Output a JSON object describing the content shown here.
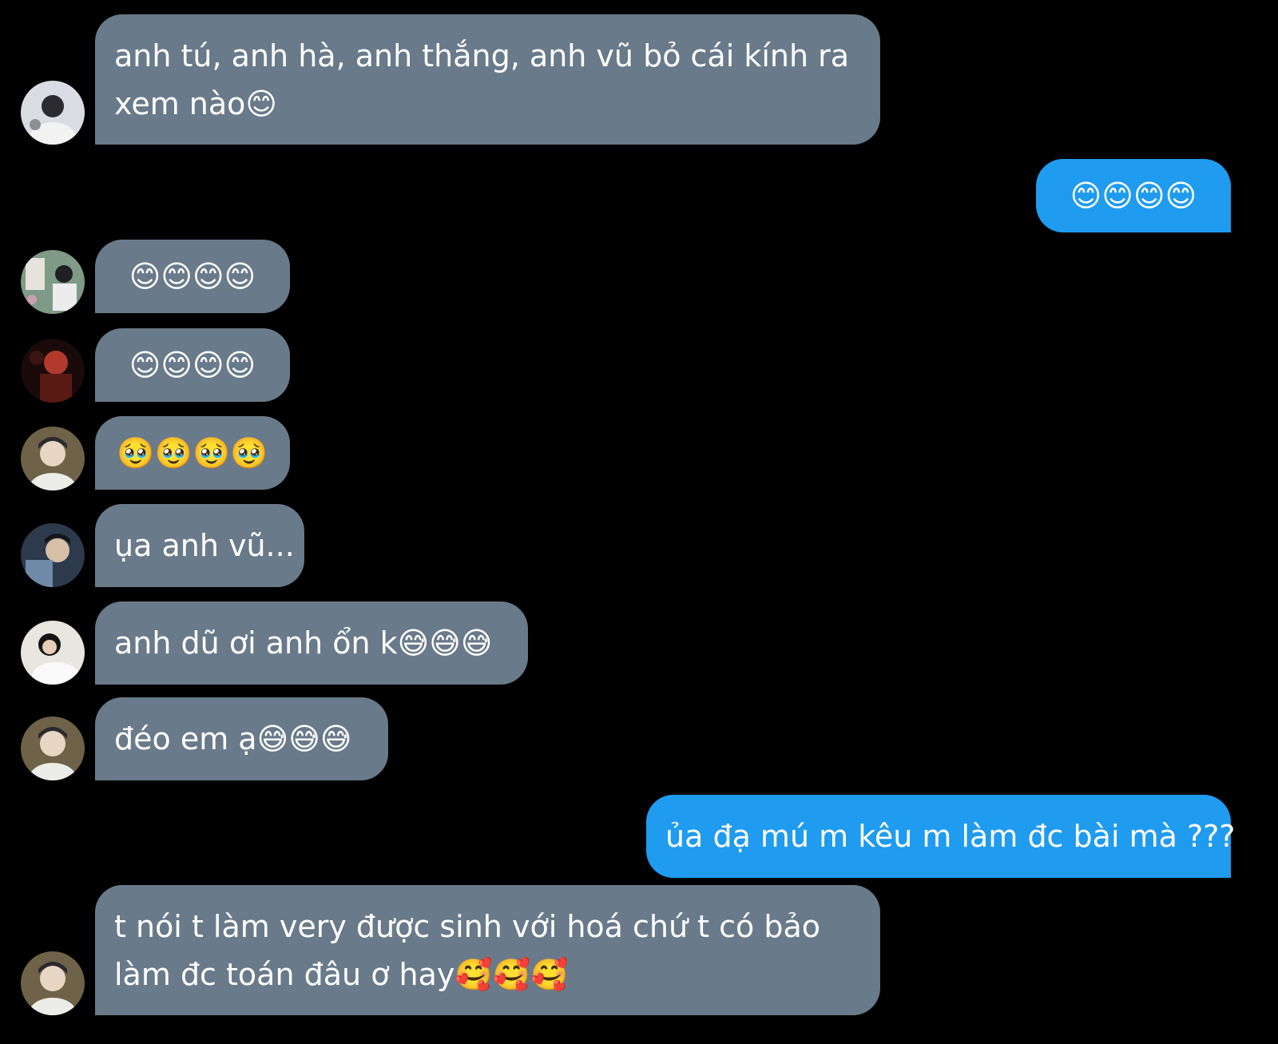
{
  "messages": [
    {
      "direction": "incoming",
      "avatar": "avatar-1",
      "text": "anh tú, anh hà, anh thắng, anh vũ bỏ cái kính ra xem nào😊"
    },
    {
      "direction": "outgoing",
      "text": "😊😊😊😊"
    },
    {
      "direction": "incoming",
      "avatar": "avatar-2",
      "text": "😊😊😊😊"
    },
    {
      "direction": "incoming",
      "avatar": "avatar-3",
      "text": "😊😊😊😊"
    },
    {
      "direction": "incoming",
      "avatar": "avatar-4",
      "text": "🥹🥹🥹🥹"
    },
    {
      "direction": "incoming",
      "avatar": "avatar-5",
      "text": "ụa anh vũ..."
    },
    {
      "direction": "incoming",
      "avatar": "avatar-6",
      "text": "anh dũ ơi anh ổn k😅😅😅"
    },
    {
      "direction": "incoming",
      "avatar": "avatar-4",
      "text": "đéo em ạ😅😅😅"
    },
    {
      "direction": "outgoing",
      "text": "ủa đạ mú m kêu m làm đc bài mà ???"
    },
    {
      "direction": "incoming",
      "avatar": "avatar-4",
      "text": "t nói t làm very được sinh với hoá chứ t có bảo làm đc toán đâu ơ hay🥰🥰🥰"
    }
  ],
  "colors": {
    "background": "#000000",
    "incoming_bubble": "#697a8a",
    "outgoing_bubble": "#1f9bf0",
    "text": "#ffffff"
  }
}
